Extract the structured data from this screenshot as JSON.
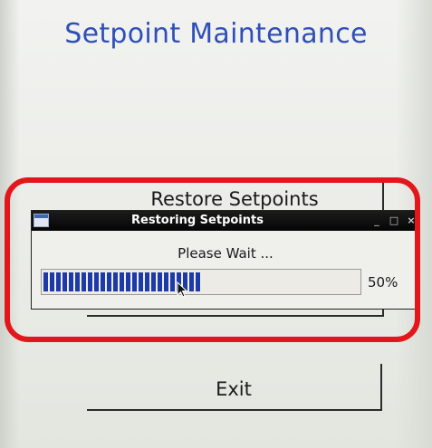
{
  "page": {
    "title": "Setpoint Maintenance"
  },
  "buttons": {
    "restore_label": "Restore Setpoints",
    "exit_label": "Exit"
  },
  "dialog": {
    "title": "Restoring Setpoints",
    "message": "Please Wait ...",
    "progress": 0.5,
    "progress_label": "50%",
    "titlebar_buttons": {
      "minimize": "_",
      "maximize": "□",
      "close": "×"
    }
  },
  "colors": {
    "title_text": "#2f4fb8",
    "progress_fill": "#1e3aa6",
    "highlight": "#e3161b",
    "titlebar": "#0a0a0a"
  },
  "icons": [
    "window-icon",
    "mouse-cursor-icon"
  ]
}
